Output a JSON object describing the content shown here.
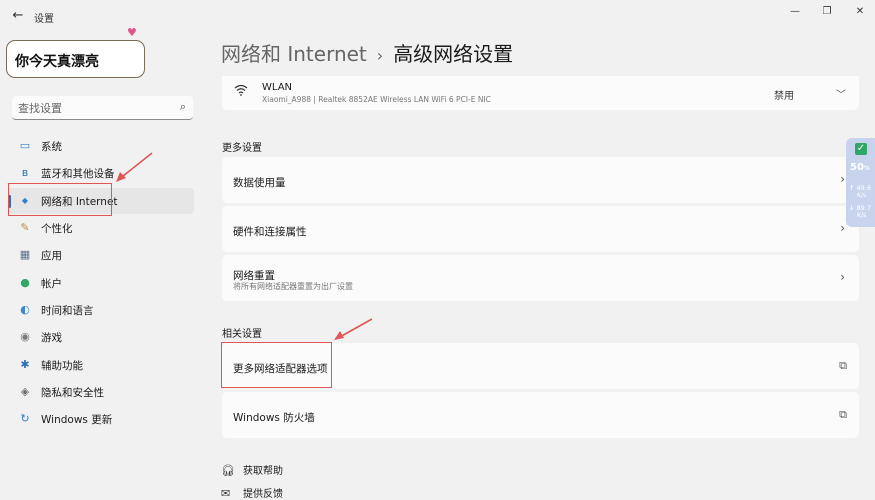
{
  "window": {
    "back_icon": "arrow-left-icon",
    "title": "设置",
    "controls": {
      "minimize": "—",
      "maximize": "❐",
      "close": "✕"
    }
  },
  "bubble": {
    "text": "你今天真漂亮",
    "heart": "♥"
  },
  "search": {
    "placeholder": "查找设置",
    "icon": "search-icon"
  },
  "sidebar": {
    "items": [
      {
        "label": "系统",
        "icon": "monitor-icon",
        "glyph": "▭",
        "color": "#2f7fd1"
      },
      {
        "label": "蓝牙和其他设备",
        "icon": "bluetooth-icon",
        "glyph": "ʙ",
        "color": "#2f6fb5"
      },
      {
        "label": "网络和 Internet",
        "icon": "wifi-icon",
        "glyph": "◆",
        "color": "#2f7fd1",
        "active": true
      },
      {
        "label": "个性化",
        "icon": "brush-icon",
        "glyph": "✎",
        "color": "#c28a3e"
      },
      {
        "label": "应用",
        "icon": "apps-icon",
        "glyph": "▦",
        "color": "#5a6f88"
      },
      {
        "label": "帐户",
        "icon": "person-icon",
        "glyph": "●",
        "color": "#2fa866"
      },
      {
        "label": "时间和语言",
        "icon": "globe-clock-icon",
        "glyph": "◐",
        "color": "#3a86d0"
      },
      {
        "label": "游戏",
        "icon": "gamepad-icon",
        "glyph": "◉",
        "color": "#7a7a7a"
      },
      {
        "label": "辅助功能",
        "icon": "accessibility-icon",
        "glyph": "✱",
        "color": "#2f6fb5"
      },
      {
        "label": "隐私和安全性",
        "icon": "shield-icon",
        "glyph": "◈",
        "color": "#6a6a6a"
      },
      {
        "label": "Windows 更新",
        "icon": "update-icon",
        "glyph": "↻",
        "color": "#2f7fd1"
      }
    ]
  },
  "header": {
    "parent": "网络和 Internet",
    "separator": "›",
    "title": "高级网络设置"
  },
  "wlan": {
    "name": "WLAN",
    "description": "Xiaomi_A988 | Realtek 8852AE Wireless LAN WiFi 6 PCI-E NIC",
    "state": "禁用"
  },
  "more_settings": {
    "label": "更多设置",
    "rows": [
      {
        "label": "数据使用量"
      },
      {
        "label": "硬件和连接属性"
      },
      {
        "label": "网络重置",
        "sub": "将所有网络适配器重置为出厂设置"
      }
    ]
  },
  "related_settings": {
    "label": "相关设置",
    "rows": [
      {
        "label": "更多网络适配器选项"
      },
      {
        "label": "Windows 防火墙"
      }
    ]
  },
  "footer": {
    "help": "获取帮助",
    "feedback": "提供反馈"
  },
  "widget": {
    "percent": "50",
    "percent_suffix": "%",
    "upload": "49.6",
    "download": "89.7",
    "unit": "K/s",
    "accent": "#2fa866"
  },
  "colors": {
    "accent": "#2f6fb5",
    "annotation": "#e05656"
  }
}
